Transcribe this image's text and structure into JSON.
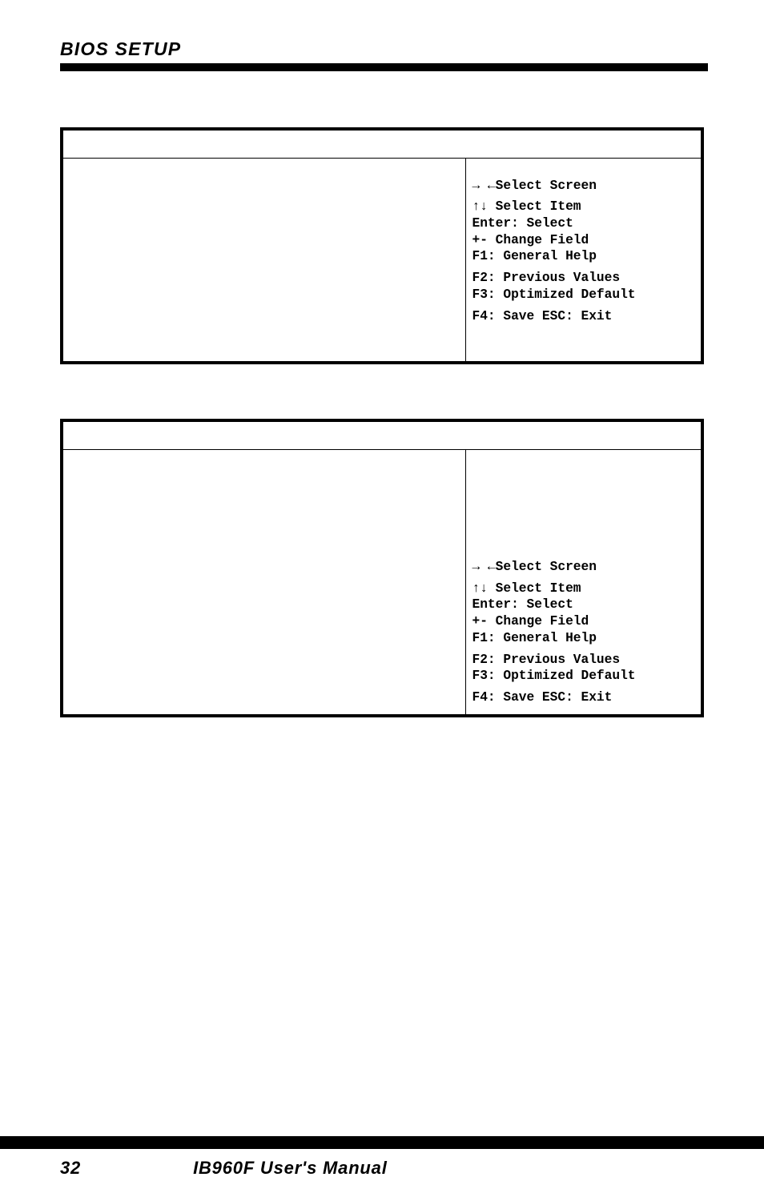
{
  "header": {
    "section_title": "BIOS SETUP"
  },
  "table1": {
    "help": {
      "select_screen": "→ ←Select Screen",
      "select_item": "↑↓ Select Item",
      "enter": "Enter: Select",
      "change_field": "+-  Change Field",
      "general_help": "F1: General Help",
      "previous_values": "F2: Previous Values",
      "optimized_default": "F3: Optimized Default",
      "save_exit": "F4: Save  ESC: Exit"
    }
  },
  "table2": {
    "help": {
      "select_screen": "→ ←Select Screen",
      "select_item": "↑↓ Select Item",
      "enter": "Enter: Select",
      "change_field": "+-  Change Field",
      "general_help": "F1: General Help",
      "previous_values": "F2: Previous Values",
      "optimized_default": "F3: Optimized Default",
      "save_exit": "F4: Save  ESC: Exit"
    }
  },
  "footer": {
    "page_number": "32",
    "manual_title": "IB960F User's Manual"
  }
}
